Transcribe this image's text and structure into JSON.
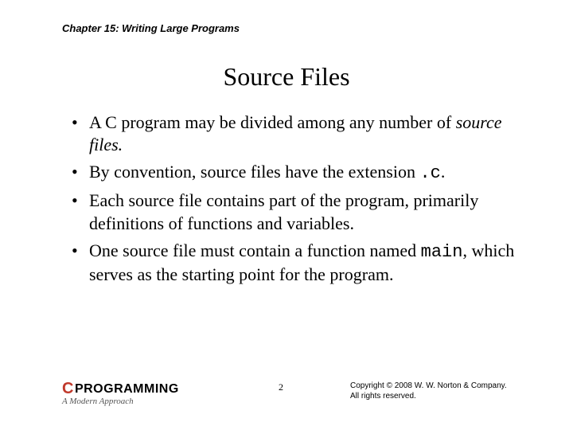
{
  "chapter": "Chapter 15: Writing Large Programs",
  "title": "Source Files",
  "bullets": {
    "b1_a": "A C program may be divided among any number of ",
    "b1_b": "source files.",
    "b2_a": "By convention, source files have the extension ",
    "b2_b": ".c",
    "b2_c": ".",
    "b3": "Each source file contains part of the program, primarily definitions of functions and variables.",
    "b4_a": "One source file must contain a function named ",
    "b4_b": "main",
    "b4_c": ", which serves as the starting point for the program."
  },
  "footer": {
    "logo_c": "C",
    "logo_rest": "PROGRAMMING",
    "logo_sub": "A Modern Approach",
    "page": "2",
    "copyright_line1": "Copyright © 2008 W. W. Norton & Company.",
    "copyright_line2": "All rights reserved."
  }
}
